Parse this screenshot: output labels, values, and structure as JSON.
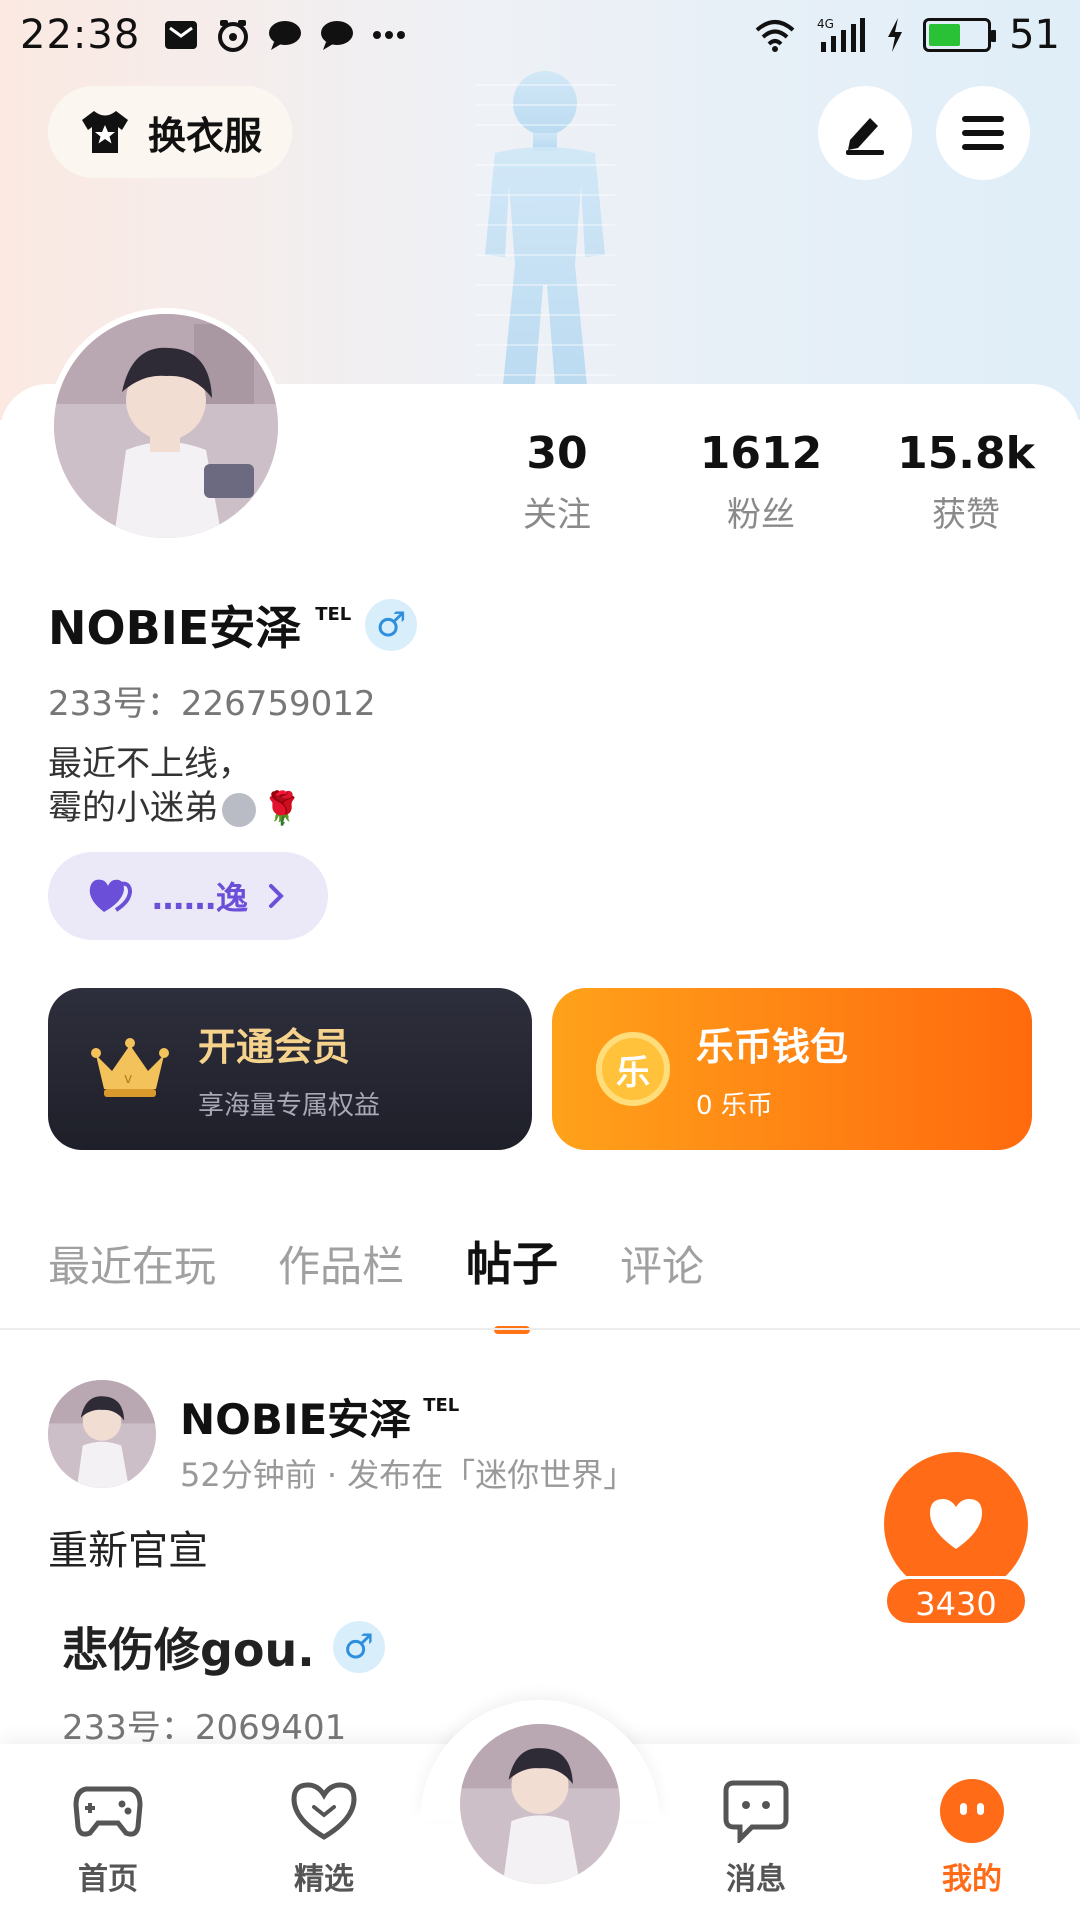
{
  "status_bar": {
    "time": "22:38",
    "battery": "51",
    "network": "4G"
  },
  "top_actions": {
    "dressup_label": "换衣服",
    "edit_icon": "pencil-icon",
    "menu_icon": "hamburger-icon"
  },
  "profile": {
    "stats": [
      {
        "value": "30",
        "label": "关注"
      },
      {
        "value": "1612",
        "label": "粉丝"
      },
      {
        "value": "15.8k",
        "label": "获赞"
      }
    ],
    "name": "NOBIE安泽",
    "badge": "TEL",
    "gender_symbol": "♂",
    "uid": "233号：226759012",
    "bio_line1": "最近不上线，",
    "bio_line2": "霉的小迷弟",
    "couple_label": "……逸"
  },
  "cards": {
    "vip_title": "开通会员",
    "vip_sub": "享海量专属权益",
    "wallet_title": "乐币钱包",
    "wallet_sub": "0 乐币",
    "wallet_coin": "乐"
  },
  "tabs": [
    "最近在玩",
    "作品栏",
    "帖子",
    "评论"
  ],
  "active_tab": "帖子",
  "post": {
    "author": "NOBIE安泽",
    "badge": "TEL",
    "meta": "52分钟前 · 发布在「迷你世界」",
    "text": "重新官宣",
    "quoted_name": "悲伤修gou.",
    "quoted_gender": "♂",
    "quoted_uid": "233号：2069401",
    "likes": "3430"
  },
  "nav": [
    {
      "label": "首页",
      "icon": "gamepad-icon"
    },
    {
      "label": "精选",
      "icon": "heart-outline-icon"
    },
    {
      "label": "",
      "icon": "avatar-center"
    },
    {
      "label": "消息",
      "icon": "chat-icon"
    },
    {
      "label": "我的",
      "icon": "profile-face-icon"
    }
  ],
  "colors": {
    "accent": "#ff6b16",
    "vip_dark": "#23242f",
    "wallet_orange": "#ff8c14",
    "gender_blue": "#2d8fdd",
    "couple_purple": "#6b4fd8"
  }
}
